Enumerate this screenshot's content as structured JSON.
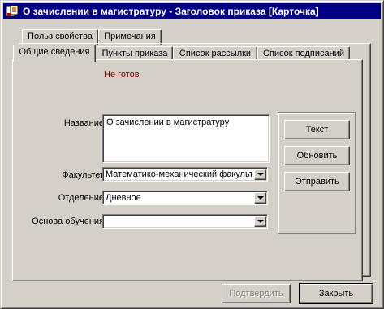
{
  "window": {
    "title": "О зачислении в магистратуру -  Заголовок приказа [Карточка]"
  },
  "tabs_back": [
    {
      "label": "Польз.свойства"
    },
    {
      "label": "Примечания"
    }
  ],
  "tabs_front": [
    {
      "label": "Общие сведения",
      "active": true
    },
    {
      "label": "Пункты приказа"
    },
    {
      "label": "Список рассылки"
    },
    {
      "label": "Список подписаний"
    }
  ],
  "form": {
    "status": "Не готов",
    "name_label": "Название",
    "name_value": "О зачислении в магистратуру",
    "faculty_label": "Факультет",
    "faculty_value": "Математико-механический факультет",
    "department_label": "Отделение",
    "department_value": "Дневное",
    "basis_label": "Основа обучения",
    "basis_value": ""
  },
  "side_buttons": {
    "text": "Текст",
    "refresh": "Обновить",
    "send": "Отправить"
  },
  "footer": {
    "confirm": "Подтвердить",
    "close": "Закрыть"
  }
}
